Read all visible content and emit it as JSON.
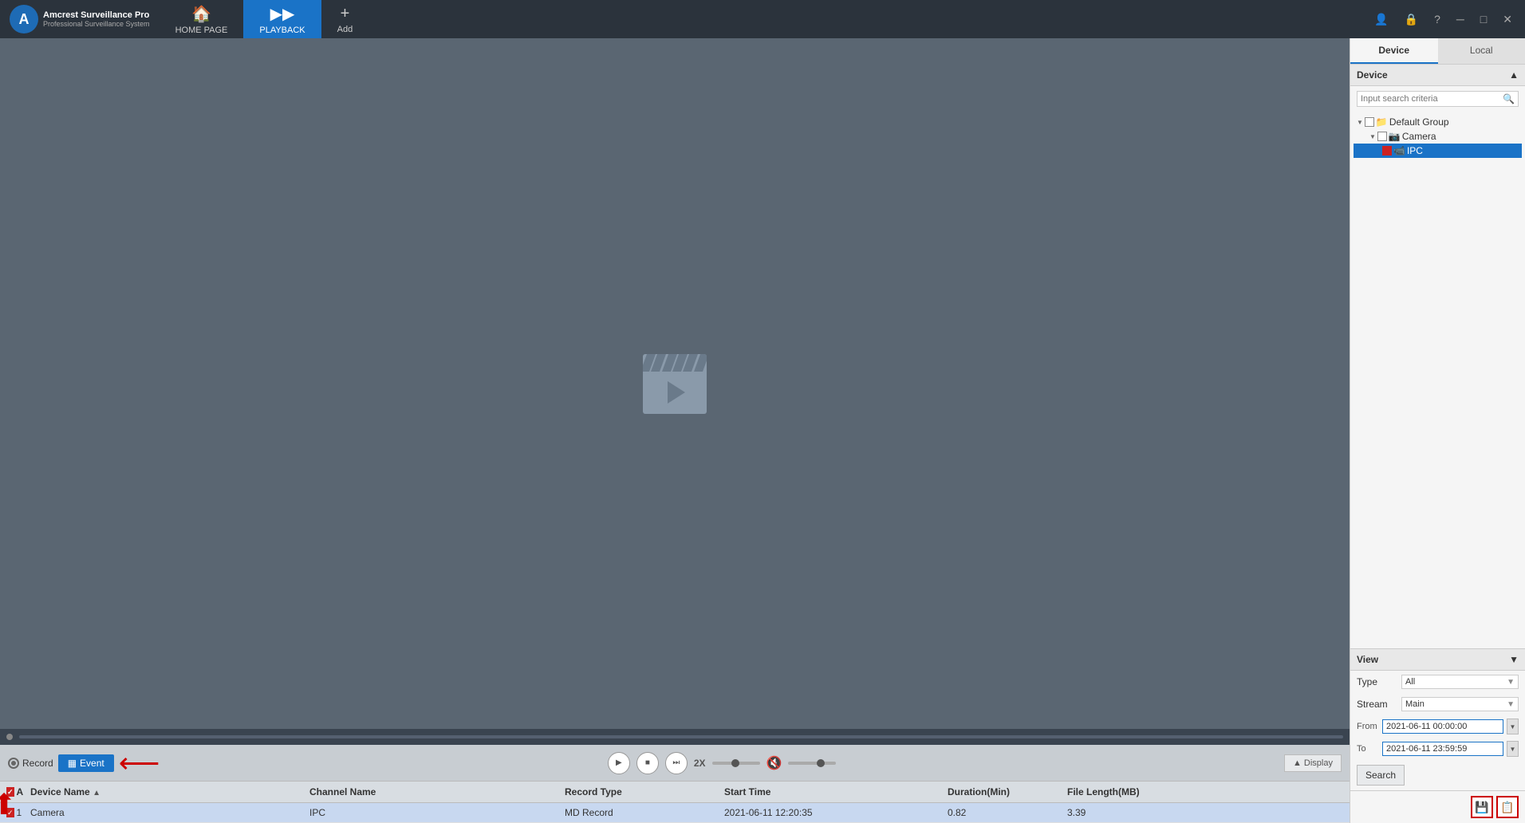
{
  "app": {
    "title": "Amcrest Surveillance Pro",
    "subtitle": "Professional Surveillance System"
  },
  "titlebar": {
    "nav": [
      {
        "id": "home",
        "label": "HOME PAGE",
        "icon": "🏠",
        "active": false
      },
      {
        "id": "playback",
        "label": "PLAYBACK",
        "icon": "▶",
        "active": true
      },
      {
        "id": "add",
        "label": "Add",
        "icon": "+",
        "active": false
      }
    ],
    "window_controls": [
      "👤",
      "🔒",
      "?",
      "□",
      "✕"
    ]
  },
  "controls": {
    "record_label": "Record",
    "event_label": "Event",
    "speed_label": "2X",
    "display_label": "Display"
  },
  "table": {
    "headers": {
      "select_all": "All",
      "device_name": "Device Name",
      "channel_name": "Channel Name",
      "record_type": "Record Type",
      "start_time": "Start Time",
      "duration": "Duration(Min)",
      "file_length": "File Length(MB)"
    },
    "rows": [
      {
        "num": "1",
        "device": "Camera",
        "channel": "IPC",
        "type": "MD Record",
        "start": "2021-06-11 12:20:35",
        "duration": "0.82",
        "size": "3.39",
        "selected": true
      }
    ]
  },
  "right_panel": {
    "tabs": [
      {
        "id": "device",
        "label": "Device",
        "active": true
      },
      {
        "id": "local",
        "label": "Local",
        "active": false
      }
    ],
    "device_section": {
      "title": "Device",
      "search_placeholder": "Input search criteria"
    },
    "tree": [
      {
        "level": 1,
        "label": "Default Group",
        "checked": false,
        "expanded": true
      },
      {
        "level": 2,
        "label": "Camera",
        "checked": false,
        "expanded": true
      },
      {
        "level": 3,
        "label": "IPC",
        "checked": true,
        "selected": true
      }
    ],
    "view_section": {
      "title": "View",
      "type_label": "Type",
      "type_value": "All",
      "stream_label": "Stream",
      "stream_value": "Main",
      "from_label": "From",
      "from_value": "2021-06-11 00:00:00",
      "to_label": "To",
      "to_value": "2021-06-11 23:59:59"
    },
    "search_btn": "Search"
  },
  "bottom_actions": {
    "save_icon": "💾",
    "export_icon": "📋"
  }
}
